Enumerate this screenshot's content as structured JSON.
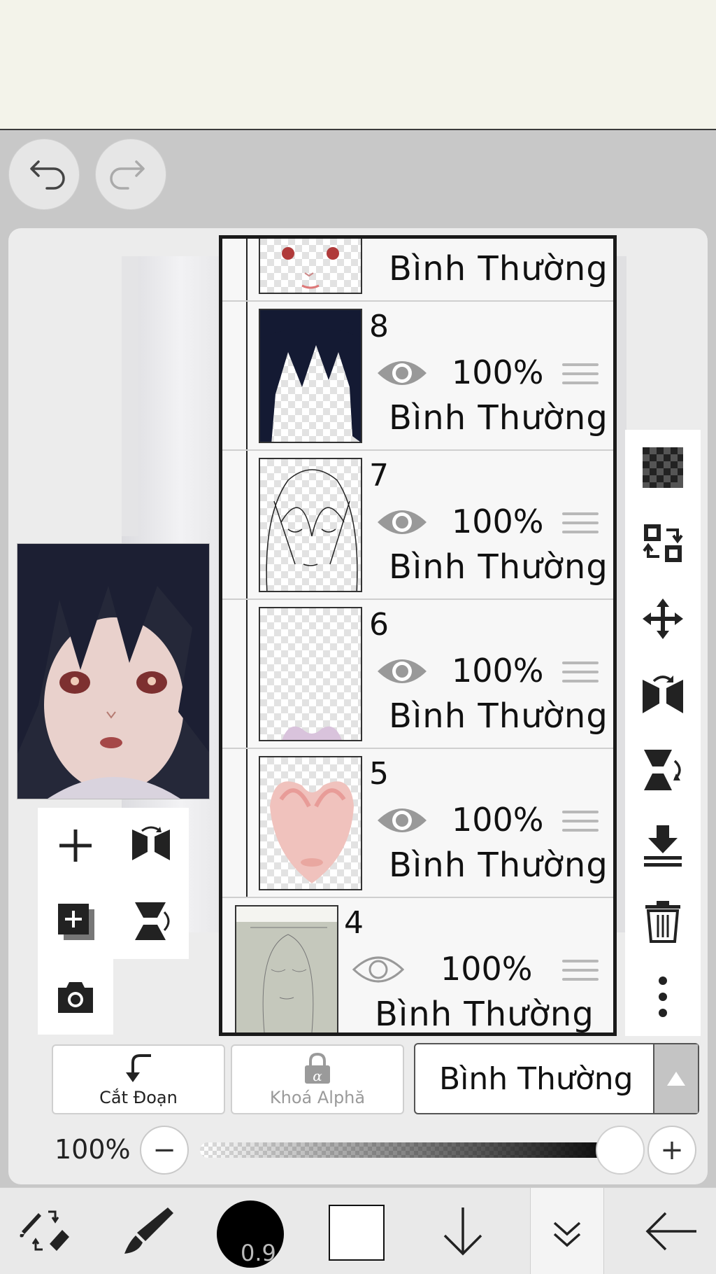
{
  "header": {
    "undo_icon": "undo-icon",
    "redo_icon": "redo-icon"
  },
  "layers": [
    {
      "number": "",
      "opacity": "100%",
      "blend": "Bình Thường",
      "thumb": "face-features"
    },
    {
      "number": "8",
      "opacity": "100%",
      "blend": "Bình Thường",
      "thumb": "dark-hair"
    },
    {
      "number": "7",
      "opacity": "100%",
      "blend": "Bình Thường",
      "thumb": "line-art"
    },
    {
      "number": "6",
      "opacity": "100%",
      "blend": "Bình Thường",
      "thumb": "collar"
    },
    {
      "number": "5",
      "opacity": "100%",
      "blend": "Bình Thường",
      "thumb": "skin-shading"
    },
    {
      "number": "4",
      "opacity": "100%",
      "blend": "Bình Thường",
      "thumb": "sketch"
    }
  ],
  "left_tools": [
    "add-layer-icon",
    "flip-horizontal-icon",
    "add-copy-layer-icon",
    "flip-vertical-icon",
    "camera-icon"
  ],
  "right_tools": [
    "transparency-icon",
    "swap-layers-icon",
    "move-icon",
    "flip-h-rotate-icon",
    "flip-v-rotate-icon",
    "merge-down-icon",
    "trash-icon",
    "more-icon"
  ],
  "bottom_controls": {
    "clip_label": "Cắt Đoạn",
    "alpha_lock_label": "Khoá Alphă",
    "blend_mode": "Bình Thường",
    "opacity_value": "100%",
    "minus": "−",
    "plus": "+"
  },
  "toolbar": {
    "brush_size": "0.9",
    "tools": [
      "brush-eraser-swap-icon",
      "brush-icon",
      "brush-size-icon",
      "color-swatch",
      "arrow-down-icon",
      "double-chevron-down-icon",
      "back-arrow-icon"
    ]
  }
}
